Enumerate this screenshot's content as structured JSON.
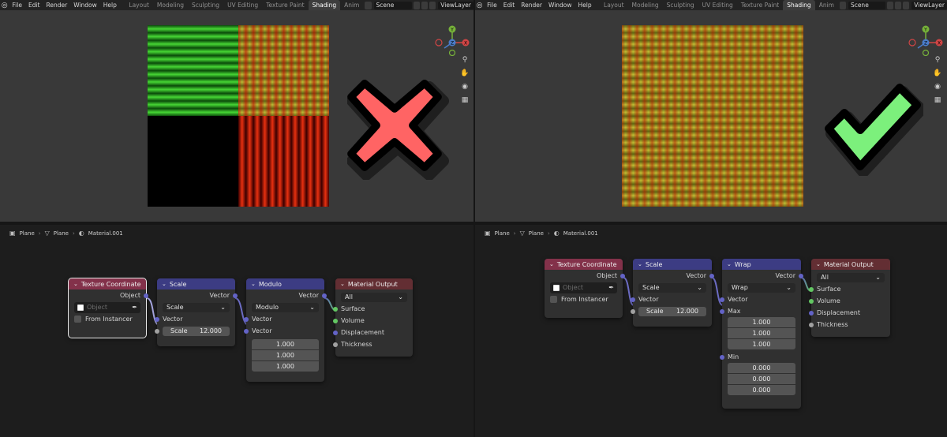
{
  "menu": [
    "File",
    "Edit",
    "Render",
    "Window",
    "Help"
  ],
  "workspaces": [
    "Layout",
    "Modeling",
    "Sculpting",
    "UV Editing",
    "Texture Paint",
    "Shading",
    "Anim"
  ],
  "active_workspace": "Shading",
  "scene_name": "Scene",
  "view_layer": "ViewLayer",
  "breadcrumb": {
    "object": "Plane",
    "mesh": "Plane",
    "material": "Material.001"
  },
  "colors": {
    "input_header": "#83314a",
    "vector_header": "#3c3c83",
    "output_header": "#632e33",
    "vector_socket": "#6363c7",
    "shader_socket": "#63c763",
    "gray_socket": "#a1a1a1",
    "cross": "#ff6464",
    "check": "#7cf07c"
  },
  "left": {
    "result_icon": "cross-mark-icon",
    "texcoord": {
      "title": "Texture Coordinate",
      "output": "Object",
      "object_placeholder": "Object",
      "from_instancer": "From Instancer"
    },
    "scale": {
      "title": "Scale",
      "output": "Vector",
      "mode": "Scale",
      "input": "Vector",
      "scale_label": "Scale",
      "scale_value": "12.000"
    },
    "op": {
      "title": "Modulo",
      "output": "Vector",
      "mode": "Modulo",
      "input1": "Vector",
      "input2": "Vector",
      "values": [
        "1.000",
        "1.000",
        "1.000"
      ]
    },
    "output": {
      "title": "Material Output",
      "target": "All",
      "sockets": [
        "Surface",
        "Volume",
        "Displacement",
        "Thickness"
      ]
    }
  },
  "right": {
    "result_icon": "check-mark-icon",
    "texcoord": {
      "title": "Texture Coordinate",
      "output": "Object",
      "object_placeholder": "Object",
      "from_instancer": "From Instancer"
    },
    "scale": {
      "title": "Scale",
      "output": "Vector",
      "mode": "Scale",
      "input": "Vector",
      "scale_label": "Scale",
      "scale_value": "12.000"
    },
    "op": {
      "title": "Wrap",
      "output": "Vector",
      "mode": "Wrap",
      "input1": "Vector",
      "max_label": "Max",
      "max_values": [
        "1.000",
        "1.000",
        "1.000"
      ],
      "min_label": "Min",
      "min_values": [
        "0.000",
        "0.000",
        "0.000"
      ]
    },
    "output": {
      "title": "Material Output",
      "target": "All",
      "sockets": [
        "Surface",
        "Volume",
        "Displacement",
        "Thickness"
      ]
    }
  }
}
